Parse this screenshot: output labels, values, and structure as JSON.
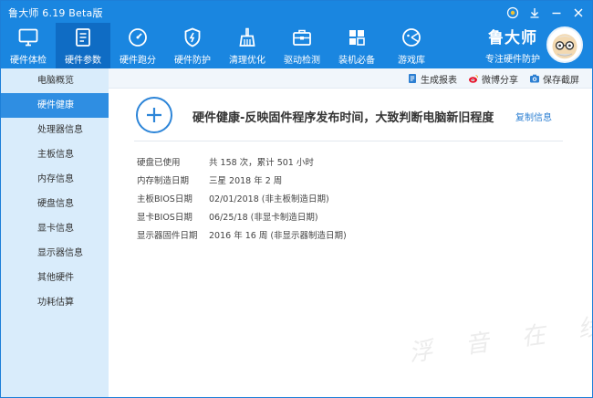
{
  "window": {
    "title": "鲁大师 6.19 Beta版",
    "controls": [
      {
        "name": "skin-icon",
        "label": ""
      },
      {
        "name": "download-icon",
        "label": ""
      },
      {
        "name": "minimize-icon",
        "label": ""
      },
      {
        "name": "close-icon",
        "label": ""
      }
    ]
  },
  "nav": {
    "items": [
      {
        "icon": "monitor-icon",
        "label": "硬件体检"
      },
      {
        "icon": "clipboard-icon",
        "label": "硬件参数",
        "active": true
      },
      {
        "icon": "speedometer-icon",
        "label": "硬件跑分"
      },
      {
        "icon": "shield-bolt-icon",
        "label": "硬件防护"
      },
      {
        "icon": "broom-icon",
        "label": "清理优化"
      },
      {
        "icon": "toolbox-icon",
        "label": "驱动检测"
      },
      {
        "icon": "apps-grid-icon",
        "label": "装机必备"
      },
      {
        "icon": "gamepad-icon",
        "label": "游戏库"
      }
    ]
  },
  "brand": {
    "name": "鲁大师",
    "slogan": "专注硬件防护"
  },
  "sidebar": {
    "items": [
      {
        "label": "电脑概览"
      },
      {
        "label": "硬件健康",
        "active": true
      },
      {
        "label": "处理器信息"
      },
      {
        "label": "主板信息"
      },
      {
        "label": "内存信息"
      },
      {
        "label": "硬盘信息"
      },
      {
        "label": "显卡信息"
      },
      {
        "label": "显示器信息"
      },
      {
        "label": "其他硬件"
      },
      {
        "label": "功耗估算"
      }
    ]
  },
  "toolbar": {
    "report_label": "生成报表",
    "share_label": "微博分享",
    "screenshot_label": "保存截屏"
  },
  "main": {
    "headline": "硬件健康-反映固件程序发布时间，大致判断电脑新旧程度",
    "copy_label": "复制信息",
    "rows": [
      {
        "label": "硬盘已使用",
        "value": "共 158 次，累计 501 小时"
      },
      {
        "label": "内存制造日期",
        "value": "三星 2018 年 2 周"
      },
      {
        "label": "主板BIOS日期",
        "value": "02/01/2018 (非主板制造日期)"
      },
      {
        "label": "显卡BIOS日期",
        "value": "06/25/18 (非显卡制造日期)"
      },
      {
        "label": "显示器固件日期",
        "value": "2016 年 16 周 (非显示器制造日期)"
      }
    ]
  },
  "watermark": "浮 音 在 线",
  "colors": {
    "header_blue": "#1a86e0",
    "active_nav": "#0f6cc4",
    "sidebar_bg": "#d9ecfb",
    "sidebar_active": "#2f8ee2",
    "link_blue": "#2c7fd2"
  }
}
